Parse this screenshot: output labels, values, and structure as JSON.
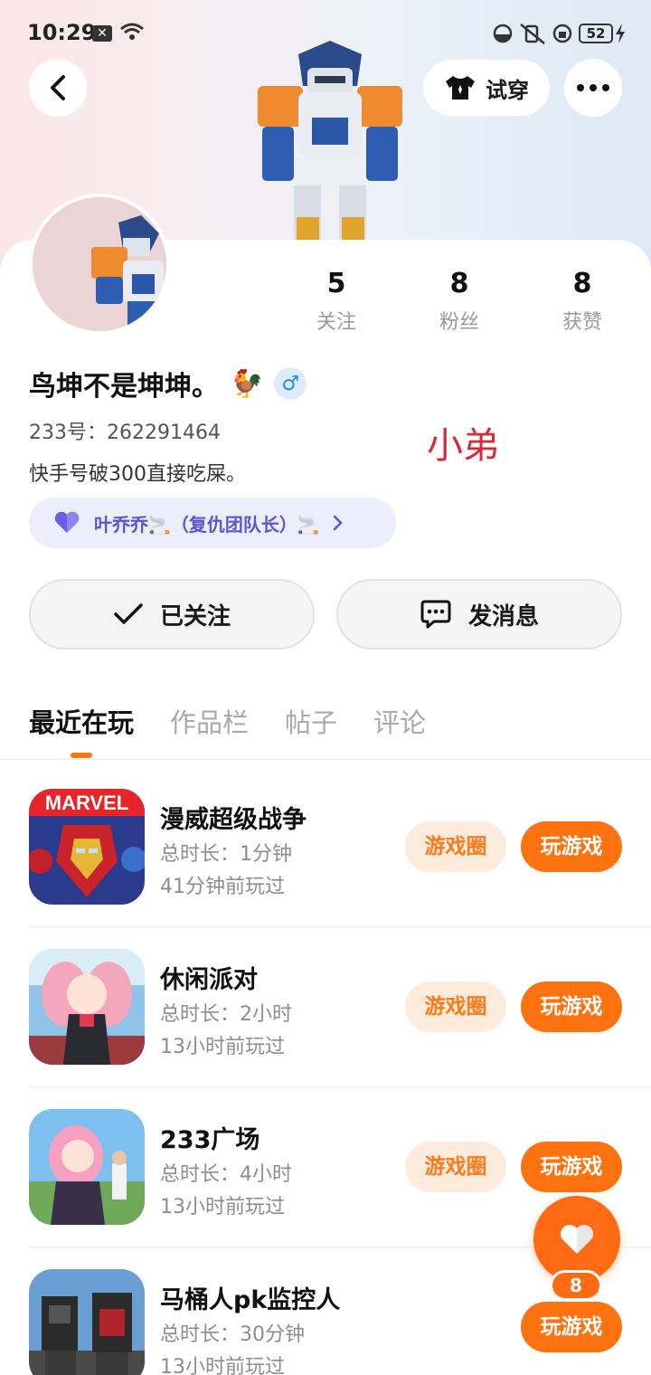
{
  "status_bar": {
    "time": "10:29",
    "notification_icon": "x-box",
    "battery_level": "52"
  },
  "header": {
    "try_on_label": "试穿"
  },
  "profile": {
    "stats": [
      {
        "value": "5",
        "label": "关注"
      },
      {
        "value": "8",
        "label": "粉丝"
      },
      {
        "value": "8",
        "label": "获赞"
      }
    ],
    "nickname": "鸟坤不是坤坤。",
    "nickname_emoji": "🐓",
    "gender_symbol": "♂",
    "account_id": "233号：262291464",
    "bio": "快手号破300直接吃屎。",
    "handwritten_note": "小弟",
    "relation": {
      "text": "叶乔乔🚬（复仇团队长）🚬"
    }
  },
  "actions": {
    "followed_label": "已关注",
    "message_label": "发消息"
  },
  "tabs": [
    {
      "label": "最近在玩"
    },
    {
      "label": "作品栏"
    },
    {
      "label": "帖子"
    },
    {
      "label": "评论"
    }
  ],
  "games": [
    {
      "name": "漫威超级战争",
      "duration": "总时长：1分钟",
      "last_played": "41分钟前玩过",
      "circle_label": "游戏圈",
      "play_label": "玩游戏",
      "icon_text": "MARVEL"
    },
    {
      "name": "休闲派对",
      "duration": "总时长：2小时",
      "last_played": "13小时前玩过",
      "circle_label": "游戏圈",
      "play_label": "玩游戏"
    },
    {
      "name": "233广场",
      "duration": "总时长：4小时",
      "last_played": "13小时前玩过",
      "circle_label": "游戏圈",
      "play_label": "玩游戏"
    },
    {
      "name": "马桶人pk监控人",
      "duration": "总时长：30分钟",
      "last_played": "13小时前玩过",
      "play_label": "玩游戏"
    }
  ],
  "like_fab": {
    "count": "8"
  },
  "colors": {
    "accent": "#ff7210",
    "tag_text": "#5a54d8",
    "note_red": "#d8283a"
  }
}
